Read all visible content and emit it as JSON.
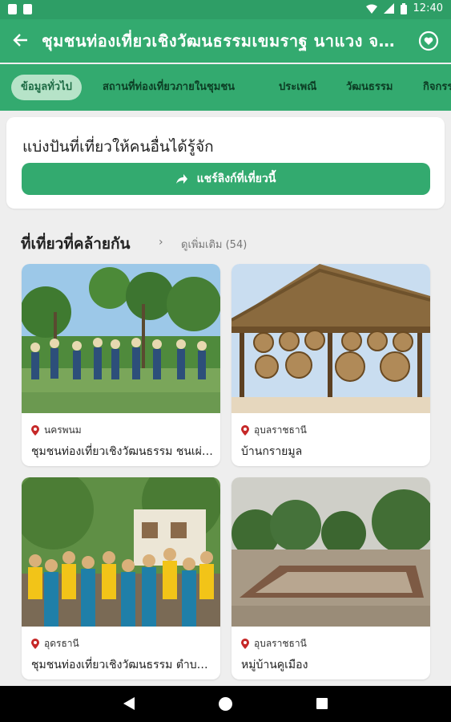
{
  "status_bar": {
    "time": "12:40"
  },
  "app_bar": {
    "title": "ชุมชนท่องเที่ยวเชิงวัฒนธรรมเขมราฐ นาแวง จ.อุบลราชธานี"
  },
  "tabs": [
    {
      "label": "ข้อมูลทั่วไป",
      "active": true
    },
    {
      "label": "สถานที่ท่องเที่ยวภายในชุมชน",
      "active": false
    },
    {
      "label": "ประเพณี",
      "active": false
    },
    {
      "label": "วัฒนธรรม",
      "active": false
    },
    {
      "label": "กิจกรรม",
      "active": false
    }
  ],
  "share": {
    "heading": "แบ่งปันที่เที่ยวให้คนอื่นได้รู้จัก",
    "button_label": "แชร์ลิงก์ที่เที่ยวนี้"
  },
  "similar": {
    "title": "ที่เที่ยวที่คล้ายกัน",
    "see_more": "ดูเพิ่มเติม (54)",
    "items": [
      {
        "province": "นครพนม",
        "name": "ชุมชนท่องเที่ยวเชิงวัฒนธรรม ชนเผ่าไทกะเลิง"
      },
      {
        "province": "อุบลราชธานี",
        "name": "บ้านกรายมูล"
      },
      {
        "province": "อุดรธานี",
        "name": "ชุมชนท่องเที่ยวเชิงวัฒนธรรม ตำบลบ้านเชียง"
      },
      {
        "province": "อุบลราชธานี",
        "name": "หมู่บ้านคูเมือง"
      }
    ]
  },
  "colors": {
    "primary": "#33aa6f",
    "status": "#2e9e66",
    "tab_active_bg": "#b6e3c8",
    "pin": "#c62828"
  }
}
